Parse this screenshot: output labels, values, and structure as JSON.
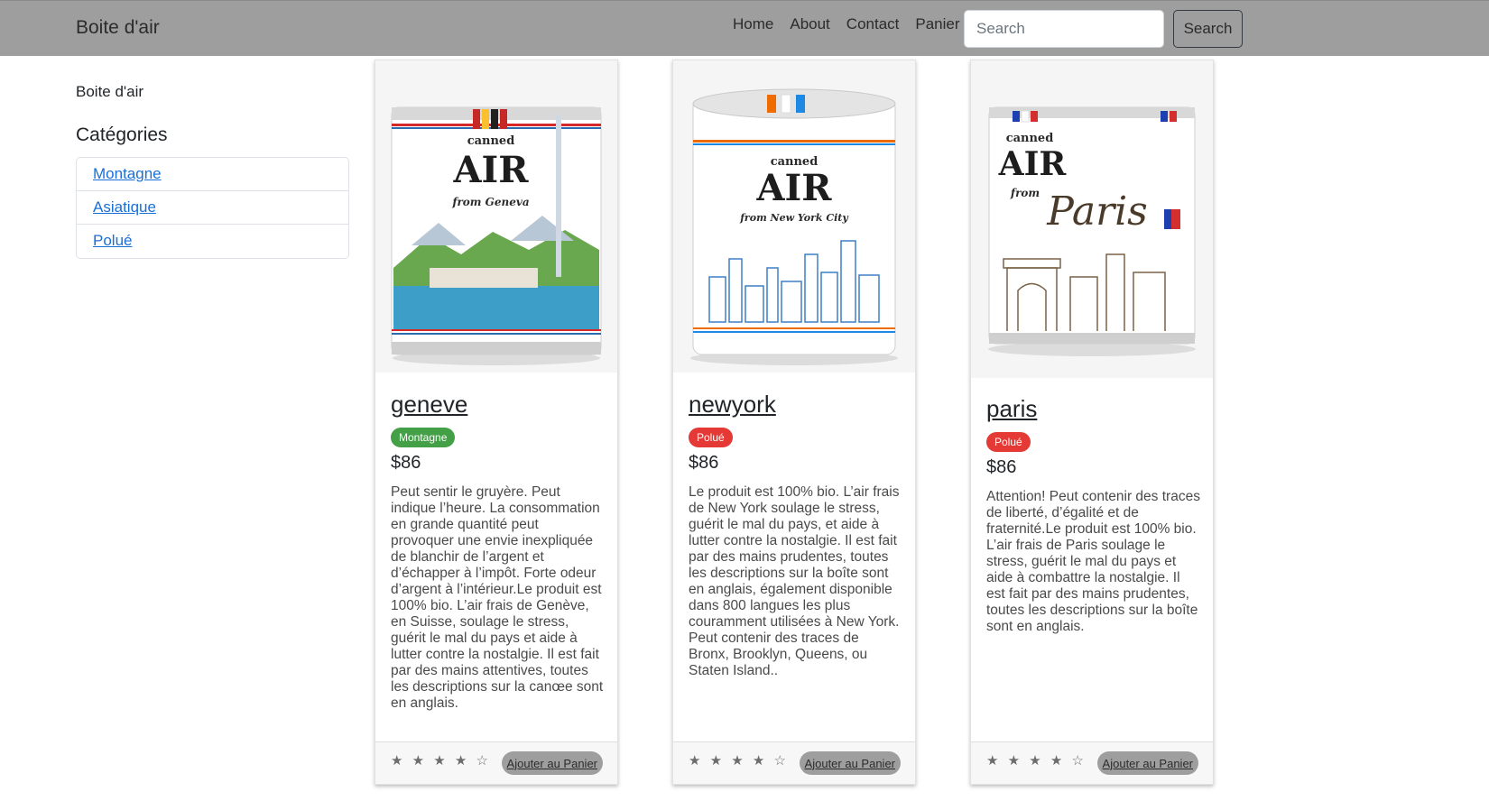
{
  "navbar": {
    "brand": "Boite d'air",
    "links": [
      "Home",
      "About",
      "Contact",
      "Panier"
    ],
    "search_placeholder": "Search",
    "search_button": "Search"
  },
  "sidebar": {
    "brand": "Boite d'air",
    "categories_title": "Catégories",
    "categories": [
      "Montagne",
      "Asiatique",
      "Polué"
    ]
  },
  "products": [
    {
      "name": "geneve",
      "badge": "Montagne",
      "badge_color": "#43a047",
      "price": "$86",
      "description": "Peut sentir le gruyère. Peut indique l’heure. La consommation en grande quantité peut provoquer une envie inexpliquée de blanchir de l’argent et d’échapper à l’impôt. Forte odeur d’argent à l’intérieur.Le produit est 100% bio. L’air frais de Genève, en Suisse, soulage le stress, guérit le mal du pays et aide à lutter contre la nostalgie. Il est fait par des mains attentives, toutes les descriptions sur la canœe sont en anglais.",
      "rating": 4,
      "stars": "★ ★ ★ ★ ☆",
      "add_button": "Ajouter au Panier",
      "can": {
        "top": "canned",
        "main": "AIR",
        "sub": "from Geneva"
      }
    },
    {
      "name": "newyork",
      "badge": "Polué",
      "badge_color": "#e53935",
      "price": "$86",
      "description": "Le produit est 100% bio. L’air frais de New York soulage le stress, guérit le mal du pays, et aide à lutter contre la nostalgie. Il est fait par des mains prudentes, toutes les descriptions sur la boîte sont en anglais, également disponible dans 800 langues les plus couramment utilisées à New York. Peut contenir des traces de Bronx, Brooklyn, Queens, ou Staten Island..",
      "rating": 4,
      "stars": "★ ★ ★ ★ ☆",
      "add_button": "Ajouter au Panier",
      "can": {
        "top": "canned",
        "main": "AIR",
        "sub": "from New York City"
      }
    },
    {
      "name": "paris",
      "badge": "Polué",
      "badge_color": "#e53935",
      "price": "$86",
      "description": "Attention! Peut contenir des traces de liberté, d’égalité et de fraternité.Le produit est 100% bio. L’air frais de Paris soulage le stress, guérit le mal du pays et aide à combattre la nostalgie. Il est fait par des mains prudentes, toutes les descriptions sur la boîte sont en anglais.",
      "rating": 4,
      "stars": "★ ★ ★ ★ ☆",
      "add_button": "Ajouter au Panier",
      "can": {
        "top": "canned",
        "main": "AIR",
        "sub": "from",
        "city": "Paris"
      }
    }
  ]
}
